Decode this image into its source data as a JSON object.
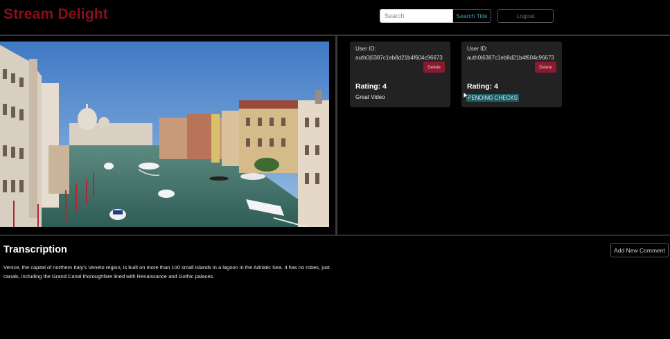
{
  "header": {
    "brand": "Stream Delight",
    "search_placeholder": "Search",
    "search_button": "Search Title",
    "logout_button": "Logout"
  },
  "video": {
    "thumbnail_icon": "video-frame"
  },
  "comments": [
    {
      "user_id_label": "User ID:",
      "user_id": "auth0|6387c1eb8d21b4f604c96673",
      "delete_label": "Delete",
      "rating": "Rating: 4",
      "comment": "Great Video"
    },
    {
      "user_id_label": "User ID:",
      "user_id": "auth0|6387c1eb8d21b4f604c96673",
      "delete_label": "Delete",
      "rating": "Rating: 4",
      "comment": "PENDING CHECKS"
    }
  ],
  "transcription": {
    "title": "Transcription",
    "text": "Venice, the capital of northern Italy's Veneto region, is built on more than 100 small islands in a lagoon in the Adriatic Sea. It has no robes, just canals, including the Grand Canal thoroughfare lined with Renaissance and Gothic palaces.",
    "add_comment_button": "Add New Comment"
  },
  "colors": {
    "brand": "#8b0e1a",
    "search_button_text": "#3aa3b8",
    "delete_button": "#8b1a2e",
    "pending_highlight": "#1d5d68",
    "card_bg": "#222222"
  }
}
